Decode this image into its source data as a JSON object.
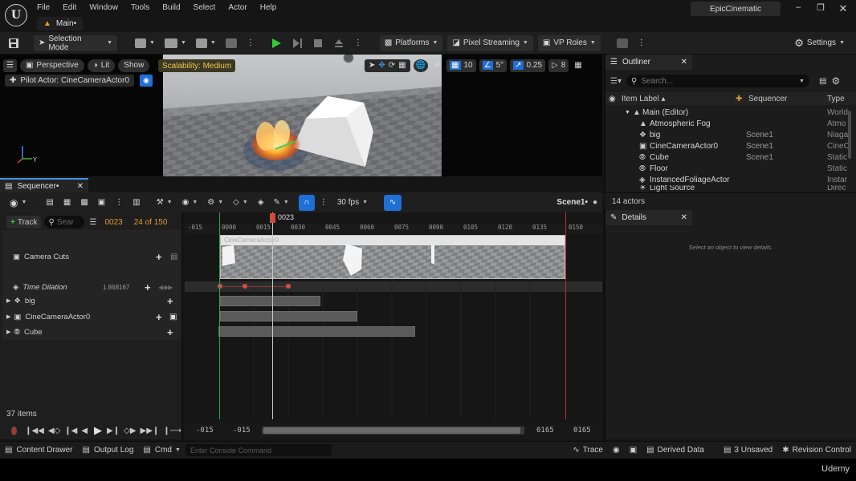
{
  "menu": [
    "File",
    "Edit",
    "Window",
    "Tools",
    "Build",
    "Select",
    "Actor",
    "Help"
  ],
  "main_tab": "Main•",
  "project_name": "EpicCinematic",
  "toolbar": {
    "selection_mode": "Selection Mode",
    "platforms": "Platforms",
    "pixel_streaming": "Pixel Streaming",
    "vp_roles": "VP Roles",
    "settings": "Settings"
  },
  "viewport": {
    "perspective": "Perspective",
    "lit": "Lit",
    "show": "Show",
    "scalability": "Scalability: Medium",
    "pilot_actor": "Pilot Actor: CineCameraActor0",
    "grid_value": "10",
    "angle_value": "5°",
    "scale_value": "0.25",
    "camera_speed": "8"
  },
  "outliner": {
    "title": "Outliner",
    "search_placeholder": "Search...",
    "col_item_label": "Item Label ▴",
    "col_sequencer": "Sequencer",
    "col_type": "Type",
    "rows": [
      {
        "label": "Main (Editor)",
        "seq": "",
        "type": "World"
      },
      {
        "label": "Atmospheric Fog",
        "seq": "",
        "type": "Atmo"
      },
      {
        "label": "big",
        "seq": "Scene1",
        "type": "Niaga"
      },
      {
        "label": "CineCameraActor0",
        "seq": "Scene1",
        "type": "CineC"
      },
      {
        "label": "Cube",
        "seq": "Scene1",
        "type": "Static"
      },
      {
        "label": "Floor",
        "seq": "",
        "type": "Static"
      },
      {
        "label": "InstancedFoliageActor",
        "seq": "",
        "type": "Instar"
      },
      {
        "label": "Light Source",
        "seq": "",
        "type": "Direc"
      }
    ],
    "count": "14 actors"
  },
  "details": {
    "title": "Details",
    "empty_text": "Select an object to view details."
  },
  "sequencer": {
    "tab": "Sequencer•",
    "fps": "30 fps",
    "scene": "Scene1•",
    "track_button": "Track",
    "search_placeholder": "Sear",
    "current_frame": "0023",
    "frame_count": "24 of 150",
    "playhead_label": "0023",
    "ruler": [
      "-015",
      "0000",
      "0015",
      "0030",
      "0045",
      "0060",
      "0075",
      "0090",
      "0105",
      "0120",
      "0135",
      "0150"
    ],
    "tracks": [
      {
        "label": "Camera Cuts"
      },
      {
        "label": "Time Dilation",
        "value": "1.868167"
      },
      {
        "label": "big"
      },
      {
        "label": "CineCameraActor0"
      },
      {
        "label": "Cube"
      }
    ],
    "shot_label": "CineCameraActor0",
    "items_count": "37 items",
    "range_start": "-015",
    "range_start2": "-015",
    "range_end": "0165",
    "range_end2": "0165"
  },
  "statusbar": {
    "content_drawer": "Content Drawer",
    "output_log": "Output Log",
    "cmd": "Cmd",
    "console_placeholder": "Enter Console Command",
    "trace": "Trace",
    "derived_data": "Derived Data",
    "unsaved": "3 Unsaved",
    "revision_control": "Revision Control"
  },
  "watermark": "Udemy",
  "colors": {
    "accent_blue": "#1f6fd6",
    "play_green": "#37c837",
    "scalability_yellow": "#f0c850",
    "playhead_red": "#d04a3a",
    "timeline_orange": "#e09a30"
  }
}
